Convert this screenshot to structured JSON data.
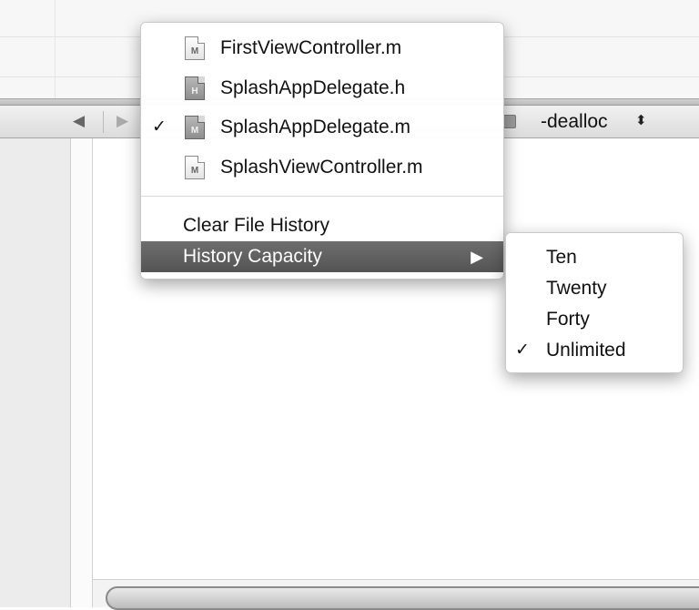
{
  "editor": {
    "nav_back_icon": "triangle-left",
    "nav_forward_icon": "triangle-right",
    "method_label": "-dealloc",
    "method_updown_icon": "updown-arrows"
  },
  "file_history_menu": {
    "files": [
      {
        "name": "FirstViewController.m",
        "type_letter": "M",
        "checked": false,
        "current": false
      },
      {
        "name": "SplashAppDelegate.h",
        "type_letter": "H",
        "checked": false,
        "current": true
      },
      {
        "name": "SplashAppDelegate.m",
        "type_letter": "M",
        "checked": true,
        "current": true
      },
      {
        "name": "SplashViewController.m",
        "type_letter": "M",
        "checked": false,
        "current": false
      }
    ],
    "check_mark": "✓",
    "clear_label": "Clear File History",
    "capacity_label": "History Capacity",
    "highlight_color": "#5f5f5f"
  },
  "history_capacity_submenu": {
    "options": [
      {
        "label": "Ten",
        "checked": false
      },
      {
        "label": "Twenty",
        "checked": false
      },
      {
        "label": "Forty",
        "checked": false
      },
      {
        "label": "Unlimited",
        "checked": true
      }
    ],
    "check_mark": "✓"
  }
}
